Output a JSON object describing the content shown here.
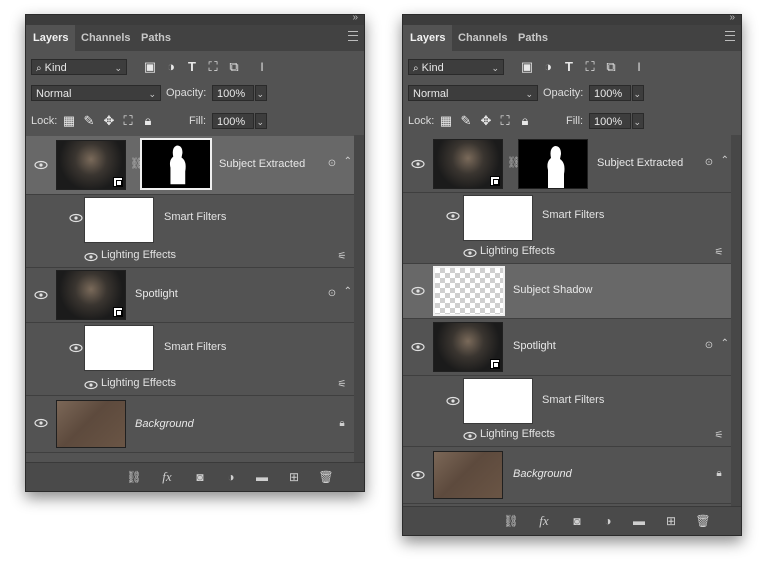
{
  "panels": [
    {
      "tabs": [
        "Layers",
        "Channels",
        "Paths"
      ],
      "filter": {
        "search_icon": "search-icon",
        "value": "Kind"
      },
      "blend": {
        "mode": "Normal",
        "opacity_label": "Opacity:",
        "opacity": "100%"
      },
      "lock": {
        "label": "Lock:",
        "fill_label": "Fill:",
        "fill": "100%"
      },
      "layers": [
        {
          "name": "Subject Extracted",
          "selected": true,
          "sub": {
            "smart_filters": "Smart Filters",
            "effect": "Lighting Effects"
          }
        },
        {
          "name": "Spotlight",
          "selected": false,
          "sub": {
            "smart_filters": "Smart Filters",
            "effect": "Lighting Effects"
          }
        },
        {
          "name": "Background",
          "selected": false
        }
      ],
      "bottom_icons": [
        "link-icon",
        "fx",
        "mask",
        "adjustment",
        "folder",
        "new-layer",
        "trash"
      ],
      "fx_label": "fx"
    },
    {
      "tabs": [
        "Layers",
        "Channels",
        "Paths"
      ],
      "filter": {
        "search_icon": "search-icon",
        "value": "Kind"
      },
      "blend": {
        "mode": "Normal",
        "opacity_label": "Opacity:",
        "opacity": "100%"
      },
      "lock": {
        "label": "Lock:",
        "fill_label": "Fill:",
        "fill": "100%"
      },
      "layers": [
        {
          "name": "Subject Extracted",
          "selected": false,
          "sub": {
            "smart_filters": "Smart Filters",
            "effect": "Lighting Effects"
          }
        },
        {
          "name": "Subject Shadow",
          "selected": true
        },
        {
          "name": "Spotlight",
          "selected": false,
          "sub": {
            "smart_filters": "Smart Filters",
            "effect": "Lighting Effects"
          }
        },
        {
          "name": "Background",
          "selected": false
        }
      ],
      "fx_label": "fx"
    }
  ],
  "colors": {
    "panel": "#535353",
    "tabbar": "#424242",
    "selected": "#686868"
  }
}
